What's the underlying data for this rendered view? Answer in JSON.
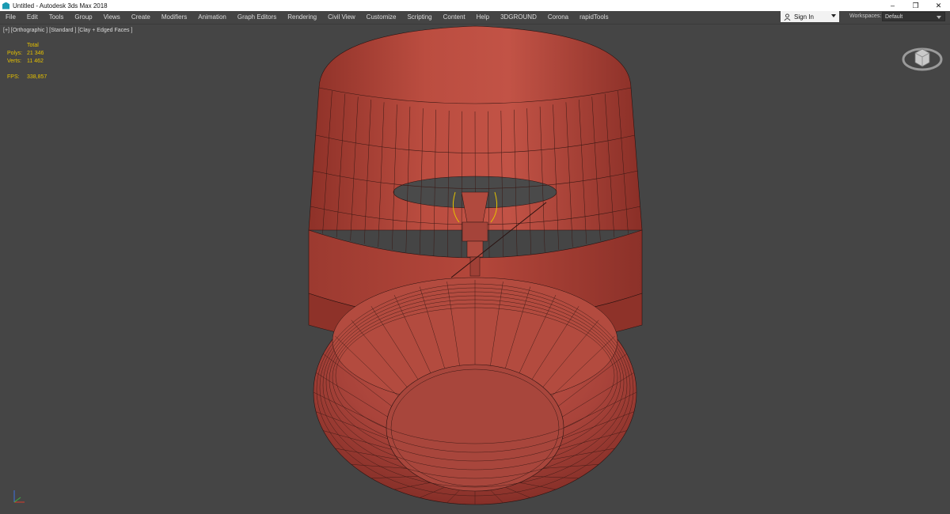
{
  "window": {
    "title": "Untitled - Autodesk 3ds Max 2018",
    "controls": {
      "minimize": "–",
      "restore": "❐",
      "close": "✕"
    }
  },
  "menu": [
    "File",
    "Edit",
    "Tools",
    "Group",
    "Views",
    "Create",
    "Modifiers",
    "Animation",
    "Graph Editors",
    "Rendering",
    "Civil View",
    "Customize",
    "Scripting",
    "Content",
    "Help",
    "3DGROUND",
    "Corona",
    "rapidTools"
  ],
  "account": {
    "sign_in": "Sign In",
    "icon": "user-icon"
  },
  "workspaces": {
    "label": "Workspaces:",
    "value": "Default"
  },
  "viewport": {
    "label": "[+] [Orthographic ] [Standard ] [Clay + Edged Faces ]",
    "stats": {
      "header": "Total",
      "polys_label": "Polys:",
      "polys_value": "21 346",
      "verts_label": "Verts:",
      "verts_value": "11 462",
      "fps_label": "FPS:",
      "fps_value": "338,857"
    },
    "background_color": "#454545",
    "clay_color": "#b2473c",
    "stats_color": "#e5c100"
  }
}
